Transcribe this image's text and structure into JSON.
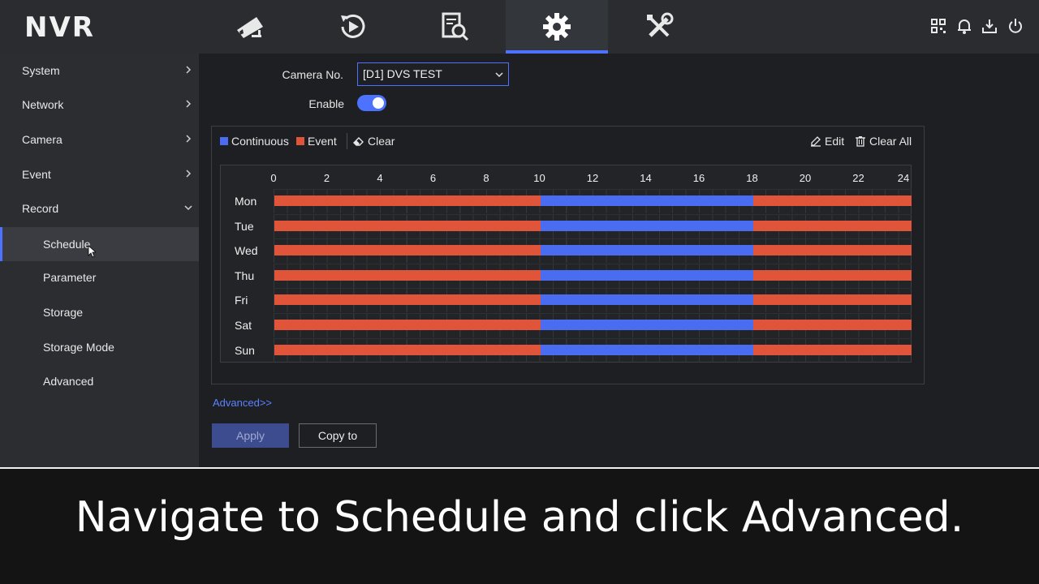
{
  "app": {
    "title": "NVR"
  },
  "nav": {
    "tabs": [
      {
        "icon": "camera-icon",
        "active": false
      },
      {
        "icon": "playback-icon",
        "active": false
      },
      {
        "icon": "search-file-icon",
        "active": false
      },
      {
        "icon": "gear-icon",
        "active": true
      },
      {
        "icon": "tools-icon",
        "active": false
      }
    ],
    "utilities": [
      "qr-code-icon",
      "bell-icon",
      "download-icon",
      "power-icon"
    ]
  },
  "sidebar": {
    "items": [
      {
        "label": "System",
        "expanded": false
      },
      {
        "label": "Network",
        "expanded": false
      },
      {
        "label": "Camera",
        "expanded": false
      },
      {
        "label": "Event",
        "expanded": false
      },
      {
        "label": "Record",
        "expanded": true
      }
    ],
    "subitems": [
      {
        "label": "Schedule",
        "selected": true
      },
      {
        "label": "Parameter"
      },
      {
        "label": "Storage"
      },
      {
        "label": "Storage Mode"
      },
      {
        "label": "Advanced"
      }
    ]
  },
  "form": {
    "camera_label": "Camera No.",
    "camera_value": "[D1] DVS TEST",
    "enable_label": "Enable",
    "enable_on": true
  },
  "legend": {
    "continuous": "Continuous",
    "event": "Event",
    "clear": "Clear",
    "edit": "Edit",
    "clear_all": "Clear All"
  },
  "colors": {
    "accent": "#4d72ff",
    "continuous": "#4a6cf0",
    "event": "#e0553a"
  },
  "schedule": {
    "hours": [
      "0",
      "2",
      "4",
      "6",
      "8",
      "10",
      "12",
      "14",
      "16",
      "18",
      "20",
      "22",
      "24"
    ],
    "days": [
      {
        "name": "Mon",
        "segments": [
          {
            "start": 0,
            "end": 10,
            "type": "event"
          },
          {
            "start": 10,
            "end": 18,
            "type": "continuous"
          },
          {
            "start": 18,
            "end": 24,
            "type": "event"
          }
        ]
      },
      {
        "name": "Tue",
        "segments": [
          {
            "start": 0,
            "end": 10,
            "type": "event"
          },
          {
            "start": 10,
            "end": 18,
            "type": "continuous"
          },
          {
            "start": 18,
            "end": 24,
            "type": "event"
          }
        ]
      },
      {
        "name": "Wed",
        "segments": [
          {
            "start": 0,
            "end": 10,
            "type": "event"
          },
          {
            "start": 10,
            "end": 18,
            "type": "continuous"
          },
          {
            "start": 18,
            "end": 24,
            "type": "event"
          }
        ]
      },
      {
        "name": "Thu",
        "segments": [
          {
            "start": 0,
            "end": 10,
            "type": "event"
          },
          {
            "start": 10,
            "end": 18,
            "type": "continuous"
          },
          {
            "start": 18,
            "end": 24,
            "type": "event"
          }
        ]
      },
      {
        "name": "Fri",
        "segments": [
          {
            "start": 0,
            "end": 10,
            "type": "event"
          },
          {
            "start": 10,
            "end": 18,
            "type": "continuous"
          },
          {
            "start": 18,
            "end": 24,
            "type": "event"
          }
        ]
      },
      {
        "name": "Sat",
        "segments": [
          {
            "start": 0,
            "end": 10,
            "type": "event"
          },
          {
            "start": 10,
            "end": 18,
            "type": "continuous"
          },
          {
            "start": 18,
            "end": 24,
            "type": "event"
          }
        ]
      },
      {
        "name": "Sun",
        "segments": [
          {
            "start": 0,
            "end": 10,
            "type": "event"
          },
          {
            "start": 10,
            "end": 18,
            "type": "continuous"
          },
          {
            "start": 18,
            "end": 24,
            "type": "event"
          }
        ]
      }
    ]
  },
  "actions": {
    "advanced_link": "Advanced>>",
    "apply": "Apply",
    "copy_to": "Copy to"
  },
  "caption": {
    "text": "Navigate to Schedule and click Advanced."
  }
}
